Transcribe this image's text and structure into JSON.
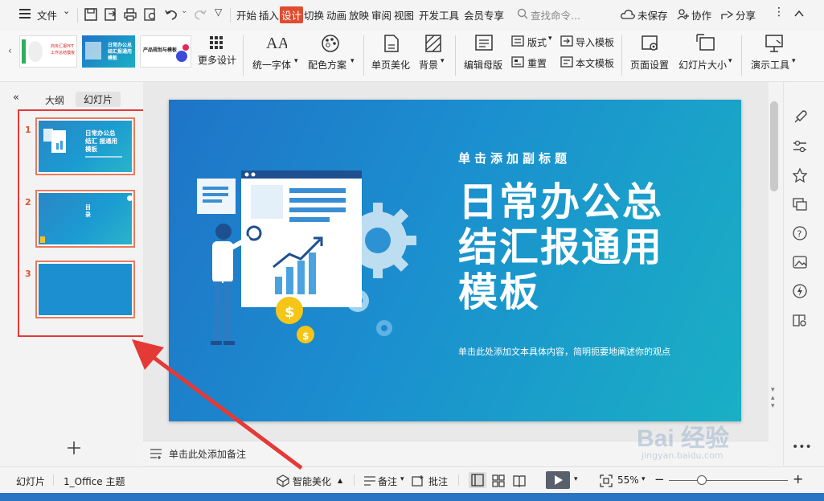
{
  "menu": {
    "file": "文件",
    "tabs": [
      "开始",
      "插入",
      "设计",
      "切换",
      "动画",
      "放映",
      "审阅",
      "视图",
      "开发工具",
      "会员专享"
    ],
    "active_tab": "设计",
    "search_placeholder": "查找命令...",
    "unsaved": "未保存",
    "collab": "协作",
    "share": "分享"
  },
  "ribbon": {
    "more_design": "更多设计",
    "unify_font": "统一字体",
    "color_scheme": "配色方案",
    "single_beautify": "单页美化",
    "background": "背景",
    "edit_master": "编辑母版",
    "layout": "版式",
    "reset": "重置",
    "import_template": "导入模板",
    "this_template": "本文模板",
    "page_setup": "页面设置",
    "slide_size": "幻灯片大小",
    "present_tools": "演示工具",
    "gallery": [
      {
        "line1": "商务汇报PPT",
        "line2": "工作总结模板"
      },
      {
        "line1": "日常办公总",
        "line2": "结汇报通用",
        "line3": "模板"
      },
      {
        "line1": "产品规划与模板"
      }
    ]
  },
  "left_panel": {
    "tab_outline": "大纲",
    "tab_slides": "幻灯片",
    "slides": [
      {
        "num": "1",
        "title_lines": [
          "日常办公总",
          "结汇 报通用",
          "模板"
        ]
      },
      {
        "num": "2",
        "label": "目录"
      },
      {
        "num": "3"
      }
    ]
  },
  "slide": {
    "subtitle": "单击添加副标题",
    "title_lines": [
      "日常办公总",
      "结汇报通用",
      "模板"
    ],
    "body": "单击此处添加文本具体内容，简明扼要地阐述你的观点"
  },
  "notes": {
    "placeholder": "单击此处添加备注"
  },
  "status": {
    "view_name": "幻灯片",
    "theme": "1_Office 主题",
    "smart_beautify": "智能美化",
    "notes": "备注",
    "comment": "批注",
    "zoom": "55%"
  },
  "watermark": {
    "text": "Bai 经验",
    "sub": "jingyan.baidu.com"
  },
  "colors": {
    "accent": "#e04c2f",
    "slide_start": "#1f74c8",
    "slide_end": "#19b0c4",
    "annotation": "#e53935"
  }
}
